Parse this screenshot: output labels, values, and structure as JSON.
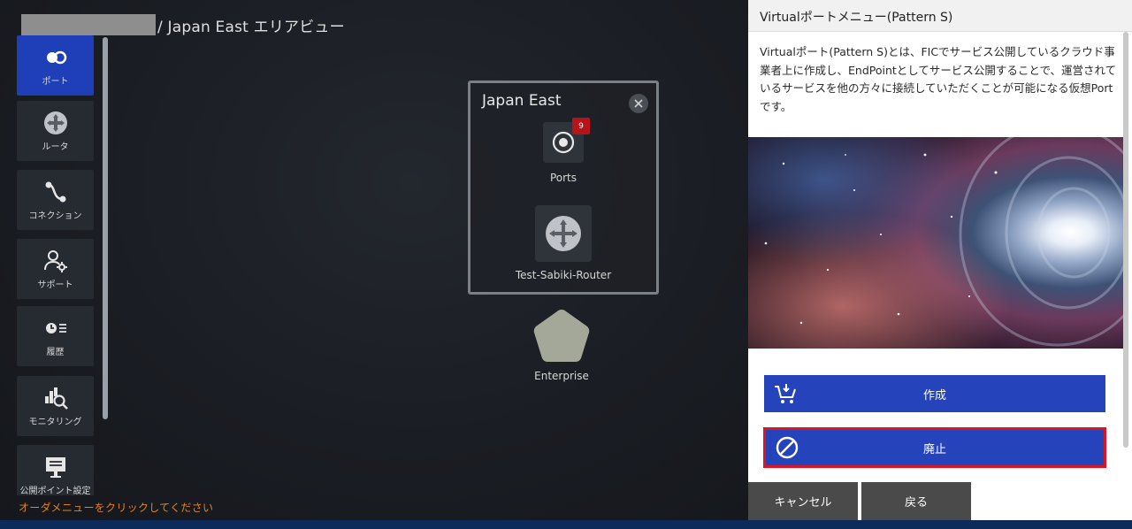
{
  "breadcrumb": {
    "current": "/ Japan East エリアビュー"
  },
  "sidebar": {
    "items": [
      {
        "label": "ポート",
        "icon": "port-icon",
        "active": true
      },
      {
        "label": "ルータ",
        "icon": "router-icon",
        "active": false
      },
      {
        "label": "コネクション",
        "icon": "connection-icon",
        "active": false
      },
      {
        "label": "サポート",
        "icon": "support-icon",
        "active": false
      },
      {
        "label": "履歴",
        "icon": "history-icon",
        "active": false
      },
      {
        "label": "モニタリング",
        "icon": "monitoring-icon",
        "active": false
      },
      {
        "label": "公開ポイント設定",
        "icon": "public-point-icon",
        "active": false
      }
    ]
  },
  "order_hint": "オーダメニューをクリックしてください",
  "region_card": {
    "title": "Japan East",
    "ports": {
      "label": "Ports",
      "badge": "9"
    },
    "router": {
      "label": "Test-Sabiki-Router"
    }
  },
  "enterprise": {
    "label": "Enterprise"
  },
  "panel": {
    "title": "Virtualポートメニュー(Pattern S)",
    "description": "Virtualポート(Pattern S)とは、FICでサービス公開しているクラウド事業者上に作成し、EndPointとしてサービス公開することで、運営されているサービスを他の方々に接続していただくことが可能になる仮想Portです。",
    "create_label": "作成",
    "delete_label": "廃止",
    "cancel_label": "キャンセル",
    "back_label": "戻る"
  },
  "colors": {
    "accent_blue": "#2544bb",
    "active_nav": "#1e3fb8",
    "badge_red": "#b8121a",
    "highlight_red": "#e0141e",
    "hint_orange": "#e0822a",
    "enterprise_node": "#a3a898"
  }
}
